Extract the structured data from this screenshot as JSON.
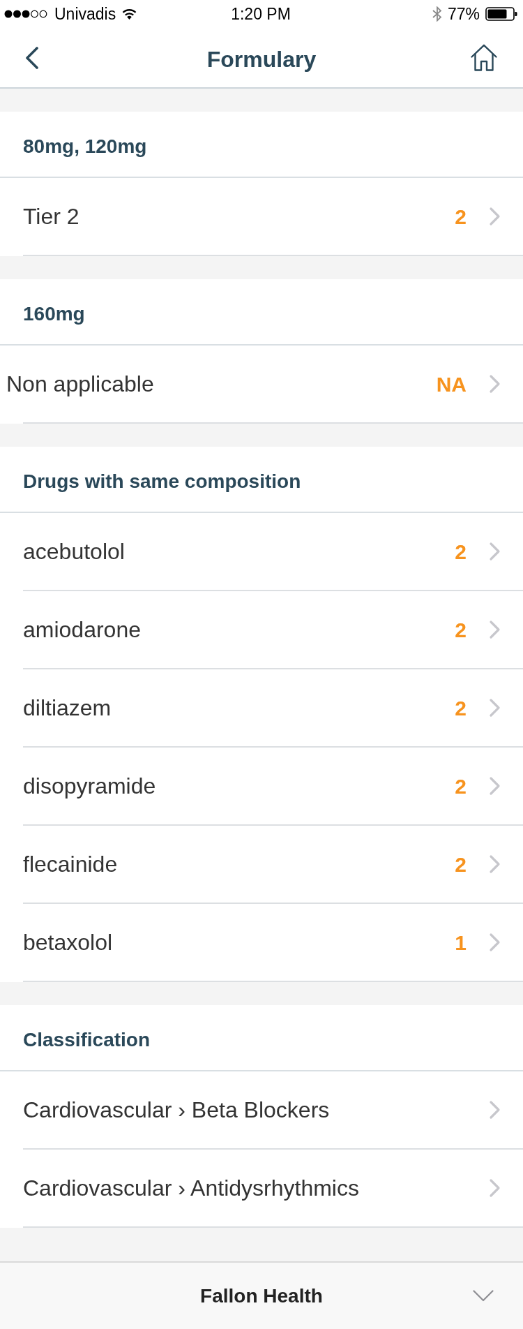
{
  "status_bar": {
    "carrier": "Univadis",
    "time": "1:20 PM",
    "battery": "77%"
  },
  "nav_bar": {
    "title": "Formulary"
  },
  "sections": [
    {
      "title": "80mg, 120mg",
      "rows": [
        {
          "label": "Tier 2",
          "value": "2"
        }
      ]
    },
    {
      "title": "160mg",
      "rows": [
        {
          "label": "Non applicable",
          "value": "NA"
        }
      ]
    },
    {
      "title": "Drugs with same composition",
      "rows": [
        {
          "label": "acebutolol",
          "value": "2"
        },
        {
          "label": "amiodarone",
          "value": "2"
        },
        {
          "label": "diltiazem",
          "value": "2"
        },
        {
          "label": "disopyramide",
          "value": "2"
        },
        {
          "label": "flecainide",
          "value": "2"
        },
        {
          "label": "betaxolol",
          "value": "1"
        }
      ]
    },
    {
      "title": "Classification",
      "rows": [
        {
          "label": "Cardiovascular › Beta Blockers"
        },
        {
          "label": "Cardiovascular › Antidysrhythmics"
        }
      ]
    }
  ],
  "footer": {
    "plan": "Fallon Health"
  }
}
